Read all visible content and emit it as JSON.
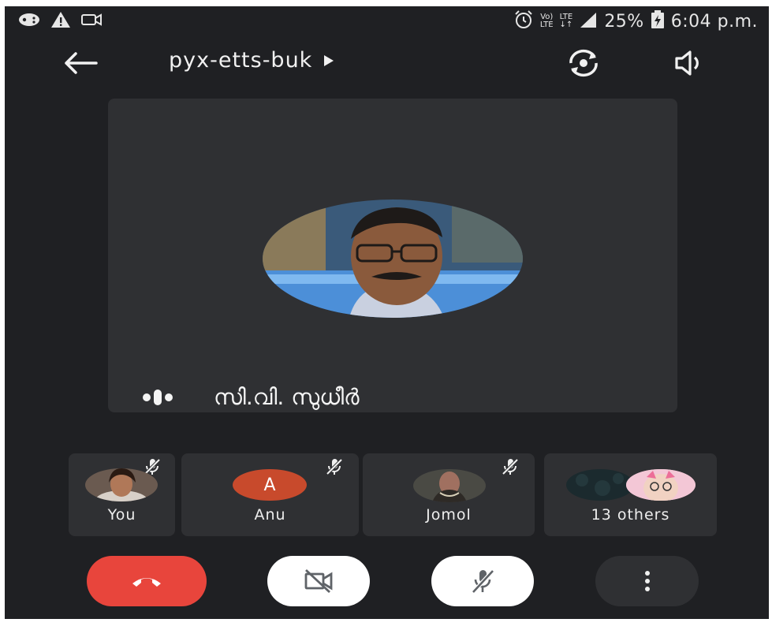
{
  "status_bar": {
    "battery": "25%",
    "time": "6:04 p.m.",
    "volte": "Vo)",
    "lte1": "LTE",
    "lte2": "LTE",
    "icons": [
      "game-icon",
      "warning-icon",
      "video-icon",
      "alarm-icon",
      "signal-icon",
      "battery-icon"
    ]
  },
  "header": {
    "title": "pyx-etts-buk",
    "icons": [
      "back-arrow-icon",
      "play-triangle-icon",
      "switch-camera-icon",
      "speaker-icon"
    ]
  },
  "main_speaker": {
    "name": "സി.വി. സുധീർ"
  },
  "participants": [
    {
      "name": "You",
      "muted": true
    },
    {
      "name": "Anu",
      "initial": "A",
      "avatar_color": "#c84a2c",
      "muted": true
    },
    {
      "name": "Jomol",
      "muted": true
    },
    {
      "name": "13 others"
    }
  ],
  "controls": {
    "end_call_color": "#e8453c",
    "icons": [
      "hang-up-icon",
      "camera-off-icon",
      "mic-off-icon",
      "more-vert-icon"
    ]
  },
  "colors": {
    "background": "#1f2023",
    "tile": "#2f3033",
    "accent_red": "#e8453c"
  }
}
